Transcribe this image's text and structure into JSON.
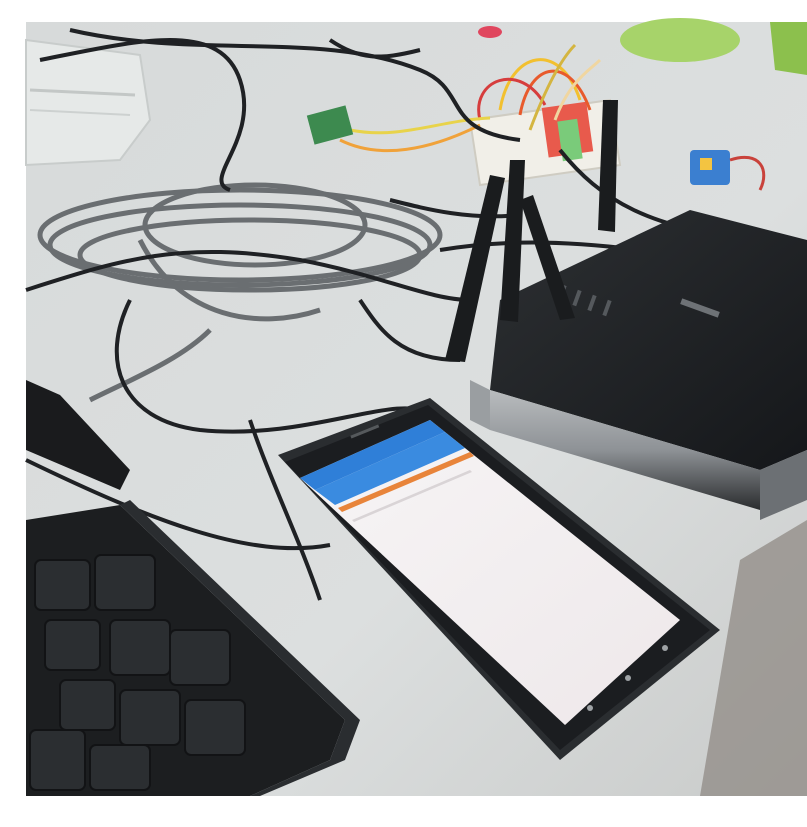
{
  "scene": {
    "photo_border_color": "#ffffff",
    "table_color": "#d9dcdc",
    "phone_screen": {
      "status_bar_color": "#2f7fd8",
      "header_bar_color": "#3a8be0",
      "accent_bar_color": "#e8843a",
      "background_color": "#f7f4f4"
    }
  }
}
